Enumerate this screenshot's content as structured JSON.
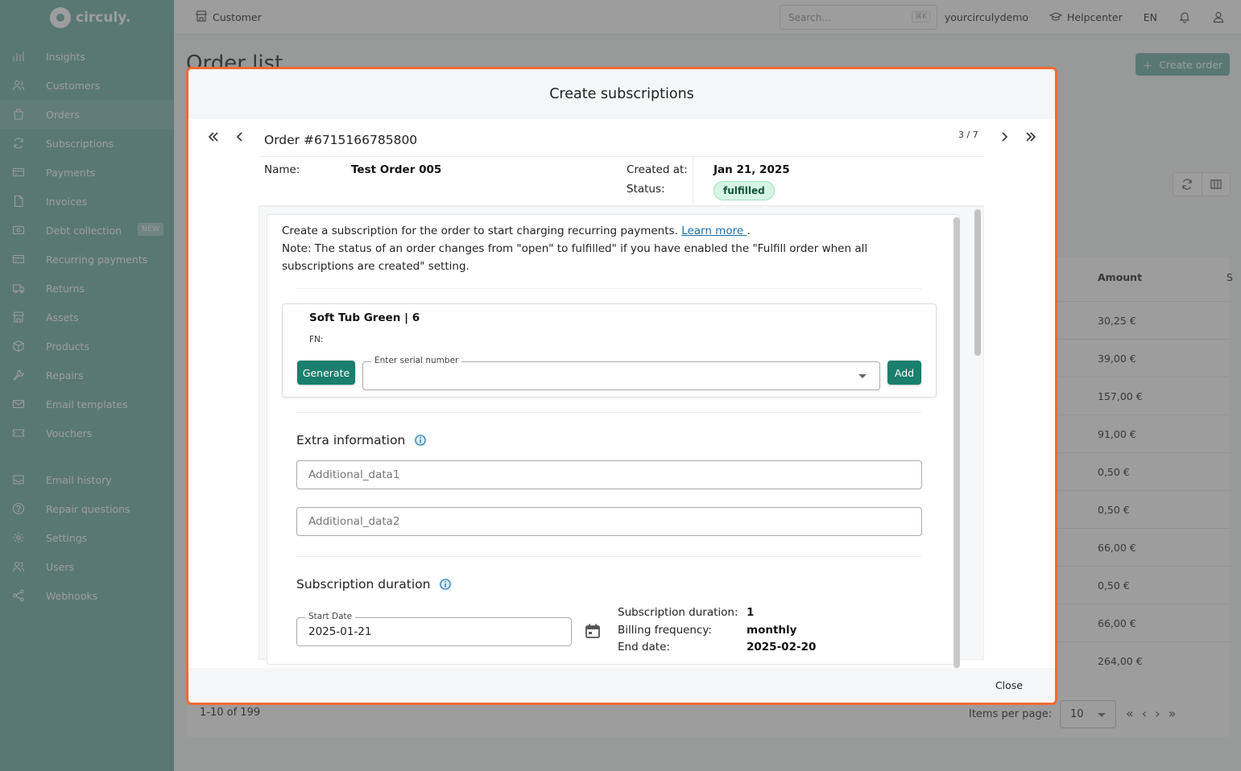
{
  "app": {
    "brand": "circuly."
  },
  "sidebar": {
    "items": [
      {
        "label": "Insights",
        "icon": "chart-icon"
      },
      {
        "label": "Customers",
        "icon": "users-icon"
      },
      {
        "label": "Orders",
        "icon": "bag-icon"
      },
      {
        "label": "Subscriptions",
        "icon": "refresh-icon"
      },
      {
        "label": "Payments",
        "icon": "card-icon"
      },
      {
        "label": "Invoices",
        "icon": "file-icon"
      },
      {
        "label": "Debt collection",
        "icon": "money-icon",
        "badge": "NEW"
      },
      {
        "label": "Recurring payments",
        "icon": "card-icon"
      },
      {
        "label": "Returns",
        "icon": "truck-icon"
      },
      {
        "label": "Assets",
        "icon": "store-icon"
      },
      {
        "label": "Products",
        "icon": "box-icon"
      },
      {
        "label": "Repairs",
        "icon": "wrench-icon"
      },
      {
        "label": "Email templates",
        "icon": "mail-icon"
      },
      {
        "label": "Vouchers",
        "icon": "ticket-icon"
      }
    ],
    "items2": [
      {
        "label": "Email history",
        "icon": "inbox-icon"
      },
      {
        "label": "Repair questions",
        "icon": "help-icon"
      },
      {
        "label": "Settings",
        "icon": "gear-icon"
      },
      {
        "label": "Users",
        "icon": "users-icon"
      },
      {
        "label": "Webhooks",
        "icon": "share-icon"
      }
    ]
  },
  "topbar": {
    "breadcrumb": "Customer",
    "search_placeholder": "Search...",
    "search_shortcut": "⌘K",
    "account": "yourcirculydemo",
    "help": "Helpcenter",
    "lang": "EN"
  },
  "page": {
    "title": "Order list",
    "create_button": "Create order",
    "amount_header": "Amount",
    "next_header": "S",
    "amounts": [
      "30,25 €",
      "39,00 €",
      "157,00 €",
      "91,00 €",
      "0,50 €",
      "0,50 €",
      "66,00 €",
      "0,50 €",
      "66,00 €",
      "264,00 €"
    ],
    "pagination": "1-10 of 199",
    "items_per_page_label": "Items per page:",
    "items_per_page": "10"
  },
  "modal": {
    "title": "Create subscriptions",
    "order_title": "Order #6715166785800",
    "page_count": "3 / 7",
    "name_label": "Name:",
    "name_value": "Test Order 005",
    "created_label": "Created at:",
    "created_value": "Jan 21, 2025",
    "status_label": "Status:",
    "status_value": "fulfilled",
    "intro_text": "Create a subscription for the order to start charging recurring payments.",
    "learn_more": "Learn more ",
    "intro_dot": ".",
    "note_text": "Note: The status of an order changes from \"open\" to fulfilled\" if you have enabled the \"Fulfill order when all subscriptions are created\" setting.",
    "product_name": "Soft Tub Green | 6",
    "product_fn": "FN:",
    "generate_label": "Generate",
    "serial_label": "Enter serial number",
    "add_label": "Add",
    "extra_title": "Extra information",
    "additional1_placeholder": "Additional_data1",
    "additional2_placeholder": "Additional_data2",
    "duration_title": "Subscription duration",
    "start_date_label": "Start Date",
    "start_date_value": "2025-01-21",
    "duration_label": "Subscription duration:",
    "duration_value": "1",
    "billing_label": "Billing frequency:",
    "billing_value": "monthly",
    "end_label": "End date:",
    "end_value": "2025-02-20",
    "close_label": "Close"
  },
  "colors": {
    "sidebar": "#76b5ac",
    "primary": "#1a7f6c",
    "modal_border": "#f06b33",
    "badge_bg": "#d7f5e6"
  }
}
